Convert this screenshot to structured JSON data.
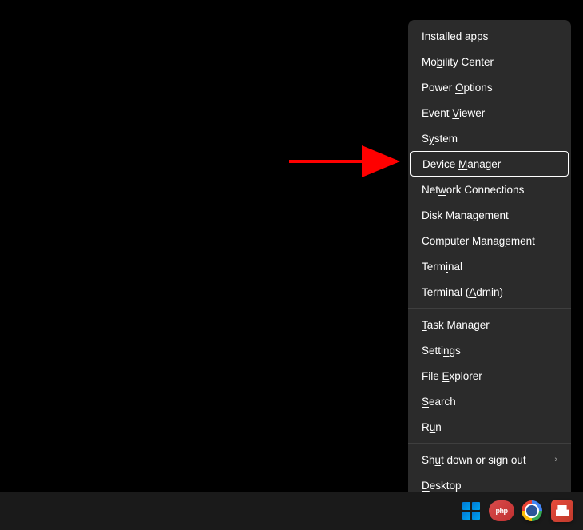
{
  "menu": {
    "group1": [
      {
        "pre": "Installed a",
        "ul": "p",
        "post": "ps"
      },
      {
        "pre": "Mo",
        "ul": "b",
        "post": "ility Center"
      },
      {
        "pre": "Power ",
        "ul": "O",
        "post": "ptions"
      },
      {
        "pre": "Event ",
        "ul": "V",
        "post": "iewer"
      },
      {
        "pre": "S",
        "ul": "y",
        "post": "stem"
      },
      {
        "pre": "Device ",
        "ul": "M",
        "post": "anager",
        "highlighted": true
      },
      {
        "pre": "Net",
        "ul": "w",
        "post": "ork Connections"
      },
      {
        "pre": "Dis",
        "ul": "k",
        "post": " Management"
      },
      {
        "pre": "Computer Mana",
        "ul": "g",
        "post": "ement"
      },
      {
        "pre": "Term",
        "ul": "i",
        "post": "nal"
      },
      {
        "pre": "Terminal (",
        "ul": "A",
        "post": "dmin)"
      }
    ],
    "group2": [
      {
        "pre": "",
        "ul": "T",
        "post": "ask Manager"
      },
      {
        "pre": "Setti",
        "ul": "n",
        "post": "gs"
      },
      {
        "pre": "File ",
        "ul": "E",
        "post": "xplorer"
      },
      {
        "pre": "",
        "ul": "S",
        "post": "earch"
      },
      {
        "pre": "R",
        "ul": "u",
        "post": "n"
      }
    ],
    "group3": [
      {
        "pre": "Sh",
        "ul": "u",
        "post": "t down or sign out",
        "submenu": true
      },
      {
        "pre": "",
        "ul": "D",
        "post": "esktop"
      }
    ]
  },
  "watermark": "php",
  "submenu_arrow": "›"
}
